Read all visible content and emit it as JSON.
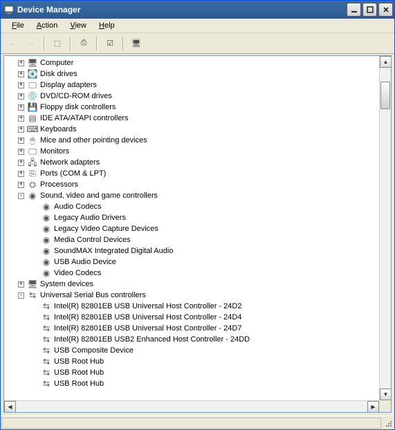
{
  "window": {
    "title": "Device Manager"
  },
  "menu": {
    "file": "File",
    "action": "Action",
    "view": "View",
    "help": "Help"
  },
  "tree": [
    {
      "depth": 0,
      "expand": "+",
      "icon": "computer-icon",
      "label": "Computer"
    },
    {
      "depth": 0,
      "expand": "+",
      "icon": "disk-icon",
      "label": "Disk drives"
    },
    {
      "depth": 0,
      "expand": "+",
      "icon": "display-icon",
      "label": "Display adapters"
    },
    {
      "depth": 0,
      "expand": "+",
      "icon": "cd-icon",
      "label": "DVD/CD-ROM drives"
    },
    {
      "depth": 0,
      "expand": "+",
      "icon": "floppy-icon",
      "label": "Floppy disk controllers"
    },
    {
      "depth": 0,
      "expand": "+",
      "icon": "ide-icon",
      "label": "IDE ATA/ATAPI controllers"
    },
    {
      "depth": 0,
      "expand": "+",
      "icon": "keyboard-icon",
      "label": "Keyboards"
    },
    {
      "depth": 0,
      "expand": "+",
      "icon": "mouse-icon",
      "label": "Mice and other pointing devices"
    },
    {
      "depth": 0,
      "expand": "+",
      "icon": "monitor-icon",
      "label": "Monitors"
    },
    {
      "depth": 0,
      "expand": "+",
      "icon": "network-icon",
      "label": "Network adapters"
    },
    {
      "depth": 0,
      "expand": "+",
      "icon": "port-icon",
      "label": "Ports (COM & LPT)"
    },
    {
      "depth": 0,
      "expand": "+",
      "icon": "cpu-icon",
      "label": "Processors"
    },
    {
      "depth": 0,
      "expand": "-",
      "icon": "sound-icon",
      "label": "Sound, video and game controllers"
    },
    {
      "depth": 1,
      "expand": "",
      "icon": "sound-icon",
      "label": "Audio Codecs"
    },
    {
      "depth": 1,
      "expand": "",
      "icon": "sound-icon",
      "label": "Legacy Audio Drivers"
    },
    {
      "depth": 1,
      "expand": "",
      "icon": "sound-icon",
      "label": "Legacy Video Capture Devices"
    },
    {
      "depth": 1,
      "expand": "",
      "icon": "sound-icon",
      "label": "Media Control Devices"
    },
    {
      "depth": 1,
      "expand": "",
      "icon": "sound-icon",
      "label": "SoundMAX Integrated Digital Audio"
    },
    {
      "depth": 1,
      "expand": "",
      "icon": "sound-icon",
      "label": "USB Audio Device"
    },
    {
      "depth": 1,
      "expand": "",
      "icon": "sound-icon",
      "label": "Video Codecs"
    },
    {
      "depth": 0,
      "expand": "+",
      "icon": "system-icon",
      "label": "System devices"
    },
    {
      "depth": 0,
      "expand": "-",
      "icon": "usb-icon",
      "label": "Universal Serial Bus controllers"
    },
    {
      "depth": 1,
      "expand": "",
      "icon": "usb-icon",
      "label": "Intel(R) 82801EB USB Universal Host Controller - 24D2"
    },
    {
      "depth": 1,
      "expand": "",
      "icon": "usb-icon",
      "label": "Intel(R) 82801EB USB Universal Host Controller - 24D4"
    },
    {
      "depth": 1,
      "expand": "",
      "icon": "usb-icon",
      "label": "Intel(R) 82801EB USB Universal Host Controller - 24D7"
    },
    {
      "depth": 1,
      "expand": "",
      "icon": "usb-icon",
      "label": "Intel(R) 82801EB USB2 Enhanced Host Controller - 24DD"
    },
    {
      "depth": 1,
      "expand": "",
      "icon": "usb-icon",
      "label": "USB Composite Device"
    },
    {
      "depth": 1,
      "expand": "",
      "icon": "usb-icon",
      "label": "USB Root Hub"
    },
    {
      "depth": 1,
      "expand": "",
      "icon": "usb-icon",
      "label": "USB Root Hub"
    },
    {
      "depth": 1,
      "expand": "",
      "icon": "usb-icon",
      "label": "USB Root Hub"
    }
  ],
  "icons": {
    "computer-icon": "🖥",
    "disk-icon": "💽",
    "display-icon": "🖵",
    "cd-icon": "💿",
    "floppy-icon": "💾",
    "ide-icon": "▤",
    "keyboard-icon": "⌨",
    "mouse-icon": "🖱",
    "monitor-icon": "🖵",
    "network-icon": "🖧",
    "port-icon": "⎘",
    "cpu-icon": "⛭",
    "sound-icon": "◉",
    "system-icon": "🖥",
    "usb-icon": "⇆"
  }
}
